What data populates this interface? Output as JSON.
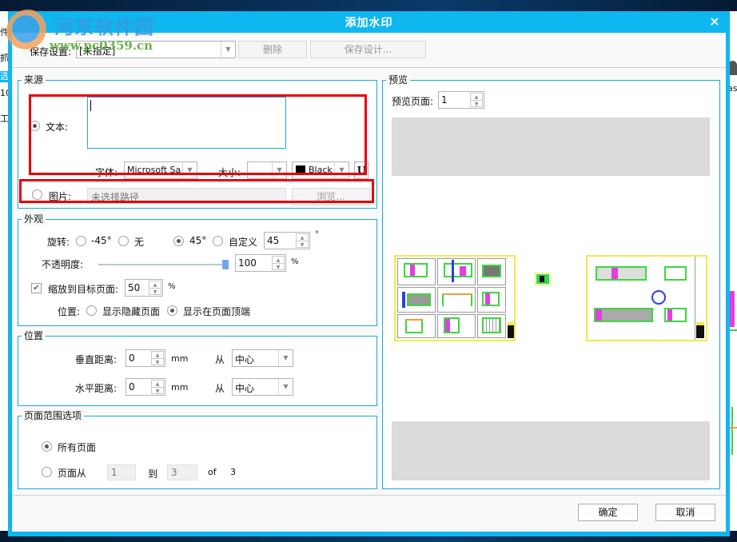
{
  "dialog": {
    "title": "添加水印",
    "close_icon": "×"
  },
  "toolbar": {
    "save_settings_label": "保存设置:",
    "save_settings_value": "[未指定]",
    "delete_label": "删除",
    "save_design_label": "保存设计..."
  },
  "source": {
    "legend": "来源",
    "text_radio_label": "文本:",
    "text_selected": true,
    "text_value": "",
    "font_label": "字体:",
    "font_value": "Microsoft Sans",
    "size_label": "大小:",
    "size_value": "",
    "color_value": "Black",
    "color_hex": "#000000",
    "underline_label": "U",
    "image_radio_label": "图片:",
    "image_selected": false,
    "image_path_placeholder": "未选择路径",
    "browse_label": "浏览..."
  },
  "appearance": {
    "legend": "外观",
    "rotation_label": "旋转:",
    "rotation_options": [
      "-45°",
      "无",
      "45°",
      "自定义"
    ],
    "rotation_selected": "45°",
    "custom_rotation_value": "45",
    "degree_unit": "°",
    "opacity_label": "不透明度:",
    "opacity_value": "100",
    "opacity_percent": 100,
    "percent_unit": "%",
    "scale_label": "缩放到目标页面:",
    "scale_checked": true,
    "scale_value": "50",
    "position_label": "位置:",
    "position_options": [
      "显示隐藏页面",
      "显示在页面顶端"
    ],
    "position_selected": "显示在页面顶端"
  },
  "position": {
    "legend": "位置",
    "vertical_label": "垂直距离:",
    "vertical_value": "0",
    "horizontal_label": "水平距离:",
    "horizontal_value": "0",
    "unit": "mm",
    "from_label": "从",
    "vertical_from": "中心",
    "horizontal_from": "中心"
  },
  "page_range": {
    "legend": "页面范围选项",
    "all_pages_label": "所有页面",
    "all_selected": true,
    "pages_from_label": "页面从",
    "from_value": "1",
    "to_label": "到",
    "to_value": "3",
    "of_label": "of",
    "total_pages": "3"
  },
  "preview": {
    "legend": "预览",
    "page_label": "预览页面:",
    "page_value": "1"
  },
  "footer": {
    "ok_label": "确定",
    "cancel_label": "取消"
  },
  "overlay_watermark": {
    "site_name": "河东软件园",
    "site_url": "www.pc0359.cn"
  },
  "background_app": {
    "left_strip": [
      "件",
      "抓",
      "选",
      "10",
      "工"
    ],
    "right_strip": [
      "as"
    ]
  }
}
